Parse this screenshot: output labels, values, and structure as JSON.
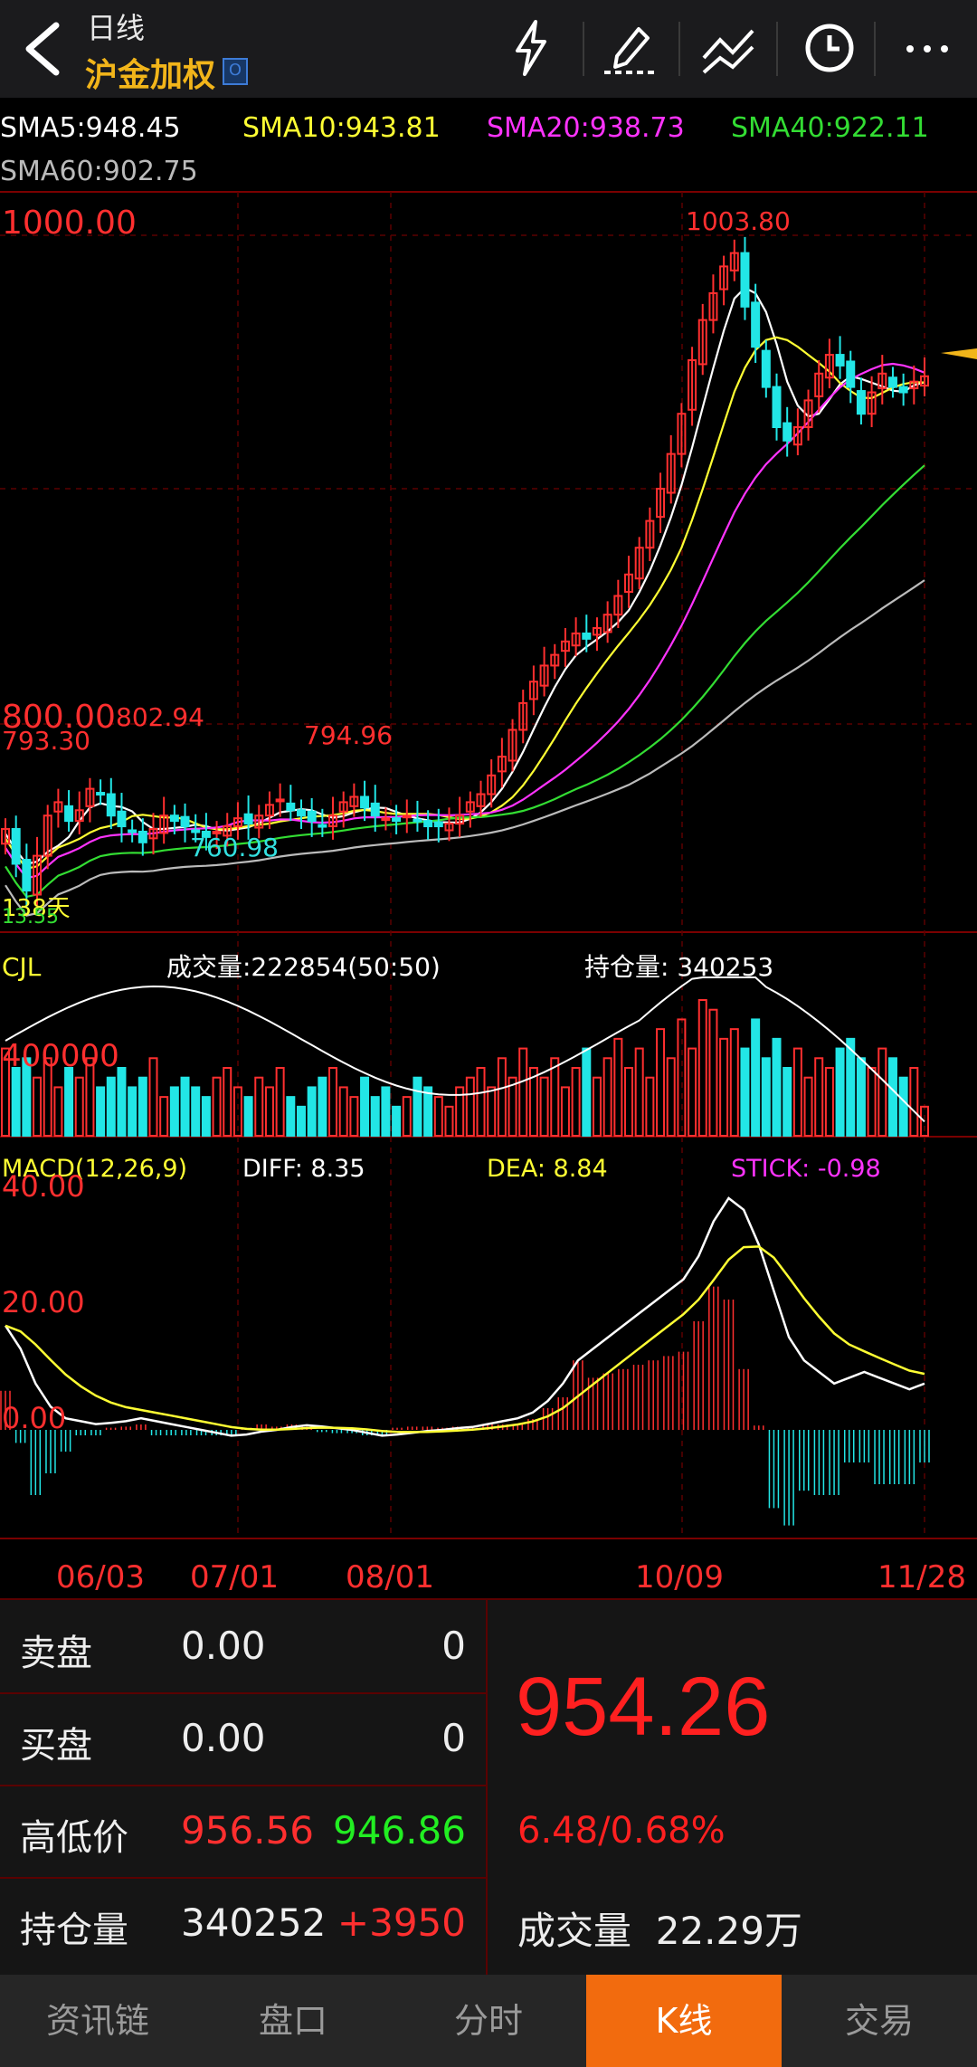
{
  "header": {
    "period": "日线",
    "title": "沪金加权",
    "badge": "O"
  },
  "toolbar": {
    "icons": [
      "flash-icon",
      "draw-pen-icon",
      "trend-line-icon",
      "clock-icon",
      "more-icon"
    ]
  },
  "legend_ma": [
    {
      "label": "SMA5:948.45",
      "color": "#ffffff"
    },
    {
      "label": "SMA10:943.81",
      "color": "#ffff33"
    },
    {
      "label": "SMA20:938.73",
      "color": "#ff33ff"
    },
    {
      "label": "SMA40:922.11",
      "color": "#33dd33"
    },
    {
      "label": "SMA60:902.75",
      "color": "#bbbbbb"
    }
  ],
  "price_labels": {
    "high_axis": "1000.00",
    "mid_axis": "800.00",
    "peak": "1003.80",
    "left_793": "793.30",
    "local_802": "802.94",
    "local_794": "794.96",
    "low": "760.98",
    "days_label": "138天",
    "days_under": "13.55"
  },
  "volume_panel": {
    "title": "CJL",
    "volume": "成交量:222854(50:50)",
    "open_interest": "持仓量: 340253",
    "axis_label": "400000"
  },
  "macd_panel": {
    "title": "MACD(12,26,9)",
    "diff": "DIFF: 8.35",
    "dea": "DEA: 8.84",
    "stick": "STICK: -0.98",
    "axis": [
      "40.00",
      "20.00",
      "0.00"
    ]
  },
  "dates": [
    "06/03",
    "07/01",
    "08/01",
    "10/09",
    "11/28"
  ],
  "quote": {
    "sell_label": "卖盘",
    "sell_price": "0.00",
    "sell_vol": "0",
    "buy_label": "买盘",
    "buy_price": "0.00",
    "buy_vol": "0",
    "hl_label": "高低价",
    "high": "956.56",
    "low": "946.86",
    "oi_label": "持仓量",
    "oi": "340252",
    "oi_change": "+3950",
    "last": "954.26",
    "change": "6.48/0.68%",
    "vol_label": "成交量",
    "vol": "22.29万"
  },
  "tabs": [
    "资讯链",
    "盘口",
    "分时",
    "K线",
    "交易"
  ],
  "active_tab": "K线",
  "colors": {
    "up": "#ff2f2f",
    "down": "#22e6e6",
    "accent": "#f26b0e",
    "title": "#f2b51a"
  },
  "chart_data": {
    "type": "candlestick",
    "price_axis": [
      760,
      1010
    ],
    "close_series": [
      785,
      772,
      762,
      775,
      790,
      795,
      788,
      792,
      800,
      798,
      790,
      786,
      784,
      780,
      785,
      790,
      788,
      786,
      784,
      782,
      784,
      786,
      789,
      787,
      790,
      794,
      796,
      792,
      790,
      788,
      786,
      790,
      795,
      797,
      793,
      790,
      789,
      788,
      790,
      788,
      786,
      786,
      787,
      790,
      795,
      798,
      805,
      812,
      822,
      832,
      840,
      846,
      850,
      855,
      858,
      856,
      860,
      865,
      872,
      880,
      890,
      900,
      912,
      925,
      940,
      960,
      975,
      985,
      995,
      1000,
      980,
      965,
      950,
      935,
      930,
      935,
      945,
      955,
      962,
      958,
      950,
      940,
      948,
      955,
      950,
      948,
      952,
      954
    ],
    "volume_series": [
      9,
      7,
      8,
      6,
      8,
      5,
      7,
      6,
      8,
      5,
      6,
      7,
      5,
      6,
      8,
      4,
      5,
      6,
      5,
      4,
      6,
      7,
      5,
      4,
      6,
      5,
      7,
      4,
      3,
      5,
      6,
      7,
      5,
      4,
      6,
      4,
      5,
      3,
      4,
      6,
      5,
      4,
      3,
      5,
      6,
      7,
      5,
      8,
      6,
      9,
      7,
      6,
      8,
      5,
      7,
      9,
      6,
      8,
      10,
      7,
      9,
      6,
      11,
      8,
      12,
      9,
      14,
      13,
      10,
      11,
      9,
      12,
      8,
      10,
      7,
      9,
      6,
      8,
      7,
      9,
      10,
      8,
      7,
      9,
      8,
      6,
      7,
      3
    ],
    "macd_series": [
      18,
      14,
      8,
      4,
      2,
      1.5,
      1,
      1.2,
      1.5,
      2,
      1.5,
      1,
      0.5,
      0,
      -0.5,
      -1,
      -0.8,
      -0.3,
      0,
      0.5,
      0.8,
      0.6,
      0.3,
      0,
      -0.5,
      -1,
      -0.8,
      -0.5,
      -0.2,
      0,
      0.3,
      0.5,
      1,
      1.5,
      2,
      3,
      5,
      8,
      12,
      14,
      16,
      18,
      20,
      22,
      24,
      26,
      30,
      36,
      40,
      38,
      32,
      24,
      16,
      12,
      10,
      8,
      9,
      10,
      9,
      8,
      7,
      8
    ],
    "ma_names": [
      "SMA5",
      "SMA10",
      "SMA20",
      "SMA40",
      "SMA60"
    ]
  }
}
